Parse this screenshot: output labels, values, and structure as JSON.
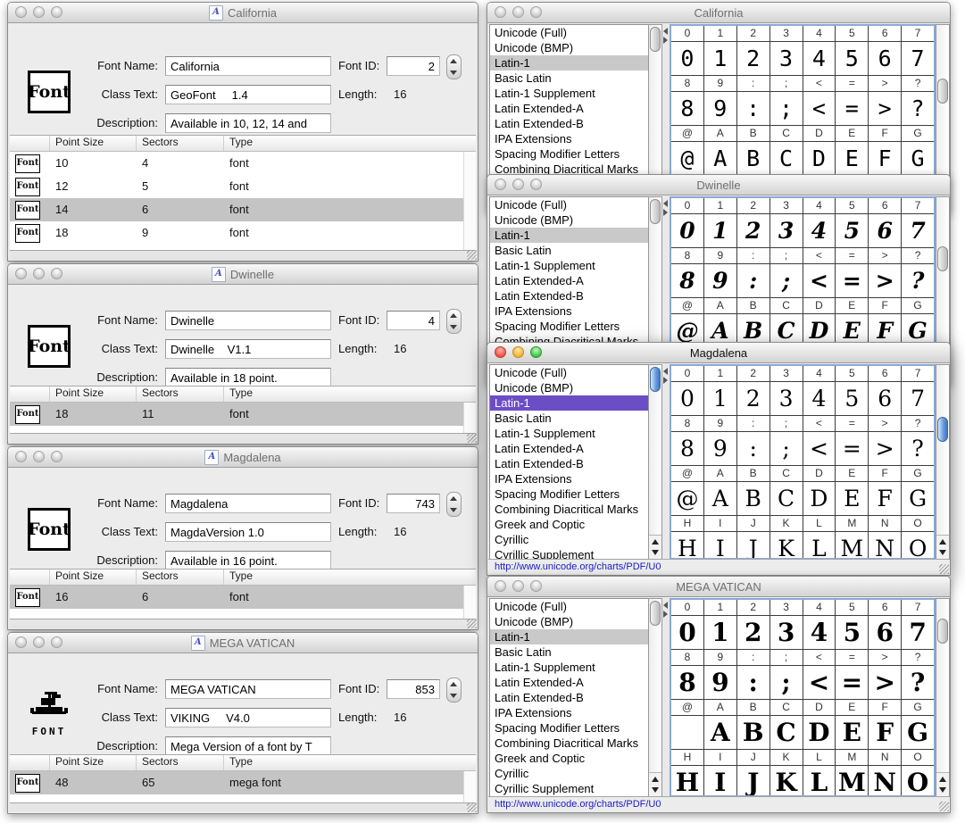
{
  "labels": {
    "font_name": "Font Name:",
    "class_text": "Class Text:",
    "description": "Description:",
    "font_id": "Font ID:",
    "length": "Length:"
  },
  "table_columns": [
    "Point Size",
    "Sectors",
    "Type"
  ],
  "icons": {
    "font_box": "Font",
    "mega_label": "FONT",
    "doc_letter": "A"
  },
  "colors": {
    "selection_inactive": "#c9c9c9",
    "selection_active": "#6b4ec6",
    "link_blue": "#1b1aca",
    "grid_focus_ring": "#8aa9d6"
  },
  "left_windows": [
    {
      "title": "California",
      "font_name": "California",
      "font_id": "2",
      "class_text": "GeoFont     1.4",
      "length": "16",
      "description": "Available in 10, 12, 14 and",
      "rows": [
        {
          "point_size": "10",
          "sectors": "4",
          "type": "font",
          "selected": false
        },
        {
          "point_size": "12",
          "sectors": "5",
          "type": "font",
          "selected": false
        },
        {
          "point_size": "14",
          "sectors": "6",
          "type": "font",
          "selected": true
        },
        {
          "point_size": "18",
          "sectors": "9",
          "type": "font",
          "selected": false
        }
      ]
    },
    {
      "title": "Dwinelle",
      "font_name": "Dwinelle",
      "font_id": "4",
      "class_text": "Dwinelle    V1.1",
      "length": "16",
      "description": "Available in 18 point.",
      "rows": [
        {
          "point_size": "18",
          "sectors": "11",
          "type": "font",
          "selected": true
        }
      ]
    },
    {
      "title": "Magdalena",
      "font_name": "Magdalena",
      "font_id": "743",
      "class_text": "MagdaVersion 1.0",
      "length": "16",
      "description": "Available in 16 point.",
      "rows": [
        {
          "point_size": "16",
          "sectors": "6",
          "type": "font",
          "selected": true
        }
      ]
    },
    {
      "title": "MEGA VATICAN",
      "font_name": "MEGA VATICAN",
      "font_id": "853",
      "class_text": "VIKING     V4.0",
      "length": "16",
      "description": "Mega Version of a font by T",
      "rows": [
        {
          "point_size": "48",
          "sectors": "65",
          "type": "mega font",
          "selected": true
        }
      ]
    }
  ],
  "right_windows": [
    {
      "title": "California",
      "active": false,
      "selected_index": 2,
      "list_items": [
        "Unicode (Full)",
        "Unicode (BMP)",
        "Latin-1",
        "Basic Latin",
        "Latin-1 Supplement",
        "Latin Extended-A",
        "Latin Extended-B",
        "IPA Extensions",
        "Spacing Modifier Letters",
        "Combining Diacritical Marks"
      ],
      "grid_rows": [
        [
          "0",
          "1",
          "2",
          "3",
          "4",
          "5",
          "6",
          "7"
        ],
        [
          "8",
          "9",
          ":",
          ";",
          "<",
          "=",
          ">",
          "?"
        ],
        [
          "@",
          "A",
          "B",
          "C",
          "D",
          "E",
          "F",
          "G"
        ]
      ],
      "blank_glyphs": [],
      "link": ""
    },
    {
      "title": "Dwinelle",
      "active": false,
      "selected_index": 2,
      "list_items": [
        "Unicode (Full)",
        "Unicode (BMP)",
        "Latin-1",
        "Basic Latin",
        "Latin-1 Supplement",
        "Latin Extended-A",
        "Latin Extended-B",
        "IPA Extensions",
        "Spacing Modifier Letters",
        "Combining Diacritical Marks"
      ],
      "grid_rows": [
        [
          "0",
          "1",
          "2",
          "3",
          "4",
          "5",
          "6",
          "7"
        ],
        [
          "8",
          "9",
          ":",
          ";",
          "<",
          "=",
          ">",
          "?"
        ],
        [
          "@",
          "A",
          "B",
          "C",
          "D",
          "E",
          "F",
          "G"
        ]
      ],
      "blank_glyphs": [],
      "link": ""
    },
    {
      "title": "Magdalena",
      "active": true,
      "selected_index": 2,
      "list_items": [
        "Unicode (Full)",
        "Unicode (BMP)",
        "Latin-1",
        "Basic Latin",
        "Latin-1 Supplement",
        "Latin Extended-A",
        "Latin Extended-B",
        "IPA Extensions",
        "Spacing Modifier Letters",
        "Combining Diacritical Marks",
        "Greek and Coptic",
        "Cyrillic",
        "Cyrillic Supplement"
      ],
      "grid_rows": [
        [
          "0",
          "1",
          "2",
          "3",
          "4",
          "5",
          "6",
          "7"
        ],
        [
          "8",
          "9",
          ":",
          ";",
          "<",
          "=",
          ">",
          "?"
        ],
        [
          "@",
          "A",
          "B",
          "C",
          "D",
          "E",
          "F",
          "G"
        ],
        [
          "H",
          "I",
          "J",
          "K",
          "L",
          "M",
          "N",
          "O"
        ]
      ],
      "blank_glyphs": [],
      "link": "http://www.unicode.org/charts/PDF/U0"
    },
    {
      "title": "MEGA VATICAN",
      "active": false,
      "selected_index": 2,
      "list_items": [
        "Unicode (Full)",
        "Unicode (BMP)",
        "Latin-1",
        "Basic Latin",
        "Latin-1 Supplement",
        "Latin Extended-A",
        "Latin Extended-B",
        "IPA Extensions",
        "Spacing Modifier Letters",
        "Combining Diacritical Marks",
        "Greek and Coptic",
        "Cyrillic",
        "Cyrillic Supplement"
      ],
      "grid_rows": [
        [
          "0",
          "1",
          "2",
          "3",
          "4",
          "5",
          "6",
          "7"
        ],
        [
          "8",
          "9",
          ":",
          ";",
          "<",
          "=",
          ">",
          "?"
        ],
        [
          "@",
          "A",
          "B",
          "C",
          "D",
          "E",
          "F",
          "G"
        ],
        [
          "H",
          "I",
          "J",
          "K",
          "L",
          "M",
          "N",
          "O"
        ]
      ],
      "blank_glyphs": [
        "@"
      ],
      "link": "http://www.unicode.org/charts/PDF/U0"
    }
  ]
}
